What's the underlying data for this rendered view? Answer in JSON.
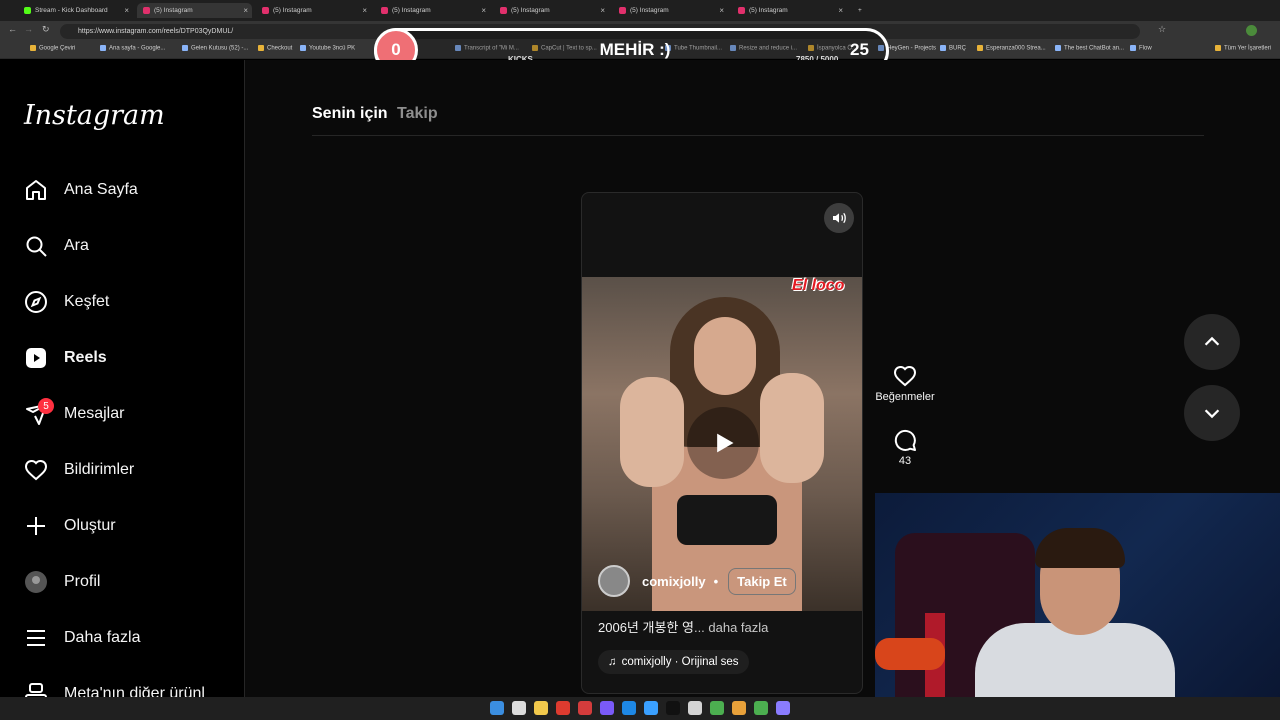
{
  "browser": {
    "tabs": [
      {
        "title": "Stream - Kick Dashboard",
        "color": "#53fc18"
      },
      {
        "title": "(5) Instagram",
        "color": "#e1306c",
        "active": true
      },
      {
        "title": "(5) Instagram",
        "color": "#e1306c"
      },
      {
        "title": "(5) Instagram",
        "color": "#e1306c"
      },
      {
        "title": "(5) Instagram",
        "color": "#e1306c"
      },
      {
        "title": "(5) Instagram",
        "color": "#e1306c"
      },
      {
        "title": "(5) Instagram",
        "color": "#e1306c"
      }
    ],
    "new_tab": "+",
    "url": "https://www.instagram.com/reels/DTP03QyDMUL/",
    "bookmarks": [
      "Google Çeviri",
      "Ana sayfa - Google...",
      "Gelen Kutusu (52) -...",
      "Checkout",
      "Youtube 3ncü PK",
      "Transcript of \"Mi M...",
      "CapCut | Text to sp...",
      "Tube Thumbnail...",
      "Resize and reduce i...",
      "İspanyolca Ö...",
      "HeyGen - Projects",
      "BURÇ",
      "Esperanza000 Strea...",
      "The best ChatBot an...",
      "Flow",
      "Tüm Yer İşaretleri"
    ]
  },
  "kick_overlay": {
    "left_score": "0",
    "title": "MEHİR :)",
    "right_score": "25",
    "label": "KICKS",
    "count": "7850  / 5000",
    "progress": 1.0
  },
  "sidebar": {
    "logo": "Instagram",
    "items": [
      {
        "label": "Ana Sayfa",
        "icon": "home-icon"
      },
      {
        "label": "Ara",
        "icon": "search-icon"
      },
      {
        "label": "Keşfet",
        "icon": "compass-icon"
      },
      {
        "label": "Reels",
        "icon": "reels-icon",
        "active": true
      },
      {
        "label": "Mesajlar",
        "icon": "messenger-icon",
        "badge": "5"
      },
      {
        "label": "Bildirimler",
        "icon": "heart-icon"
      },
      {
        "label": "Oluştur",
        "icon": "plus-icon"
      },
      {
        "label": "Profil",
        "icon": "avatar-icon"
      },
      {
        "label": "Daha fazla",
        "icon": "menu-icon"
      },
      {
        "label": "Meta'nın diğer ürünl",
        "icon": "meta-icon"
      }
    ]
  },
  "feed": {
    "tabs": [
      "Senin için",
      "Takip"
    ],
    "reel": {
      "sticker": "El loco",
      "author": "comixjolly",
      "separator": "•",
      "follow": "Takip Et",
      "caption": "2006년 개봉한 영",
      "caption_more": "... daha fazla",
      "audio": "comixjolly · Orijinal ses"
    },
    "actions": {
      "likes_label": "Beğenmeler",
      "comments_count": "43"
    }
  },
  "colors": {
    "accent_badge": "#ff3040",
    "kick_green": "#53fc18",
    "kick_score": "#ef6f75"
  }
}
